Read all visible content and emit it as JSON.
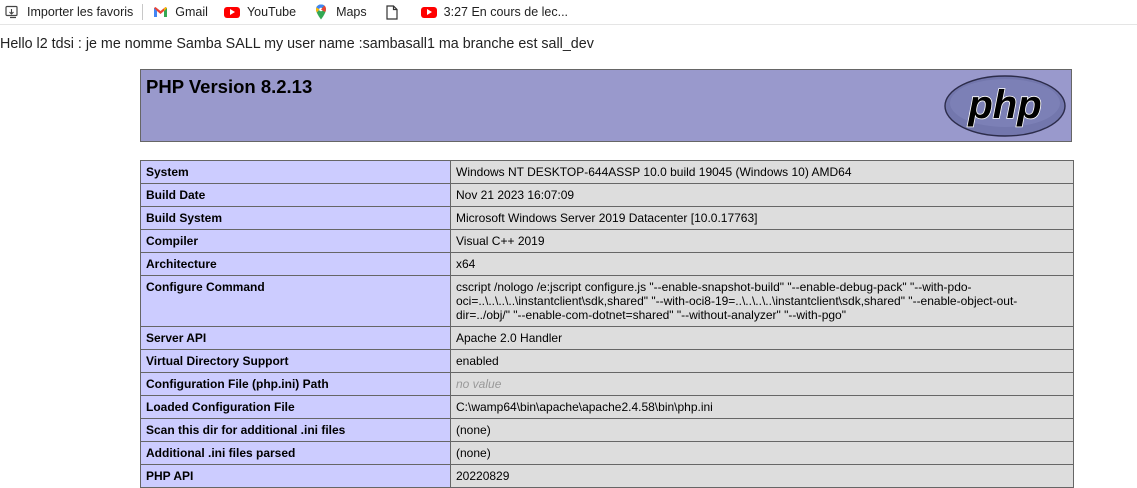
{
  "bookmarks": {
    "import_label": "Importer les favoris",
    "items": [
      {
        "label": "Gmail",
        "icon": "gmail-icon"
      },
      {
        "label": "YouTube",
        "icon": "youtube-icon"
      },
      {
        "label": "Maps",
        "icon": "maps-icon"
      },
      {
        "label": "",
        "icon": "page-icon"
      },
      {
        "label": "3:27 En cours de lec...",
        "icon": "youtube-icon"
      }
    ]
  },
  "greeting": "Hello l2 tdsi : je me nomme Samba SALL my user name :sambasall1 ma branche est sall_dev",
  "php": {
    "title": "PHP Version 8.2.13",
    "logo_text": "php"
  },
  "rows": [
    {
      "key": "System",
      "value": "Windows NT DESKTOP-644ASSP 10.0 build 19045 (Windows 10) AMD64"
    },
    {
      "key": "Build Date",
      "value": "Nov 21 2023 16:07:09"
    },
    {
      "key": "Build System",
      "value": "Microsoft Windows Server 2019 Datacenter [10.0.17763]"
    },
    {
      "key": "Compiler",
      "value": "Visual C++ 2019"
    },
    {
      "key": "Architecture",
      "value": "x64"
    },
    {
      "key": "Configure Command",
      "value": "cscript /nologo /e:jscript configure.js \"--enable-snapshot-build\" \"--enable-debug-pack\" \"--with-pdo-oci=..\\..\\..\\..\\instantclient\\sdk,shared\" \"--with-oci8-19=..\\..\\..\\..\\instantclient\\sdk,shared\" \"--enable-object-out-dir=../obj/\" \"--enable-com-dotnet=shared\" \"--without-analyzer\" \"--with-pgo\""
    },
    {
      "key": "Server API",
      "value": "Apache 2.0 Handler"
    },
    {
      "key": "Virtual Directory Support",
      "value": "enabled"
    },
    {
      "key": "Configuration File (php.ini) Path",
      "value": "no value"
    },
    {
      "key": "Loaded Configuration File",
      "value": "C:\\wamp64\\bin\\apache\\apache2.4.58\\bin\\php.ini"
    },
    {
      "key": "Scan this dir for additional .ini files",
      "value": "(none)"
    },
    {
      "key": "Additional .ini files parsed",
      "value": "(none)"
    },
    {
      "key": "PHP API",
      "value": "20220829"
    }
  ],
  "colors": {
    "header_bg": "#9999cc",
    "key_bg": "#ccccff",
    "value_bg": "#dddddd"
  }
}
